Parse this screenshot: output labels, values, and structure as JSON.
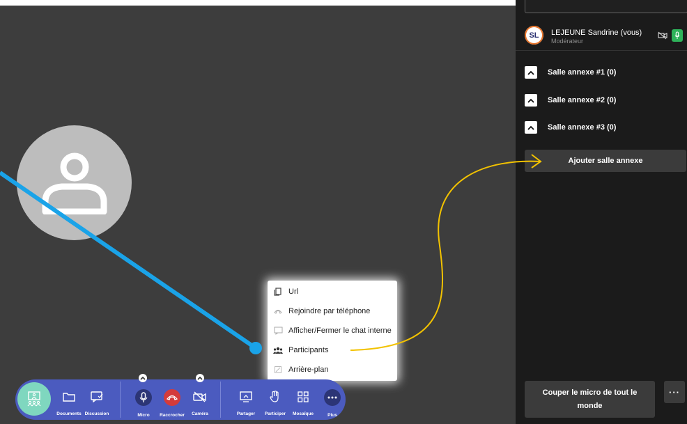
{
  "sidebar": {
    "me": {
      "initials": "SL",
      "name": "LEJEUNE Sandrine (vous)",
      "role": "Modérateur"
    },
    "rooms": [
      {
        "label": "Salle annexe #1 (0)"
      },
      {
        "label": "Salle annexe #2 (0)"
      },
      {
        "label": "Salle annexe #3 (0)"
      }
    ],
    "add_room_label": "Ajouter salle annexe",
    "mute_all_label": "Couper le micro de tout le monde",
    "more_label": "···"
  },
  "menu": {
    "items": [
      {
        "label": "Url",
        "icon": "copy-icon"
      },
      {
        "label": "Rejoindre par téléphone",
        "icon": "phone-icon"
      },
      {
        "label": "Afficher/Fermer le chat interne",
        "icon": "chat-icon"
      },
      {
        "label": "Participants",
        "icon": "people-icon"
      },
      {
        "label": "Arrière-plan",
        "icon": "background-icon"
      }
    ]
  },
  "toolbar": {
    "documents": "Documents",
    "discussion": "Discussion",
    "micro": "Micro",
    "raccrocher": "Raccrocher",
    "camera": "Caméra",
    "partager": "Partager",
    "participer": "Participer",
    "mosaique": "Mosaïque",
    "plus": "Plus"
  },
  "colors": {
    "toolbar": "#4b5bbf",
    "hangup": "#d43b3b",
    "hub": "#7fd7bf",
    "mic_active": "#2eb35a",
    "annotation_blue": "#1aa3e8",
    "annotation_yellow": "#f2c200"
  }
}
